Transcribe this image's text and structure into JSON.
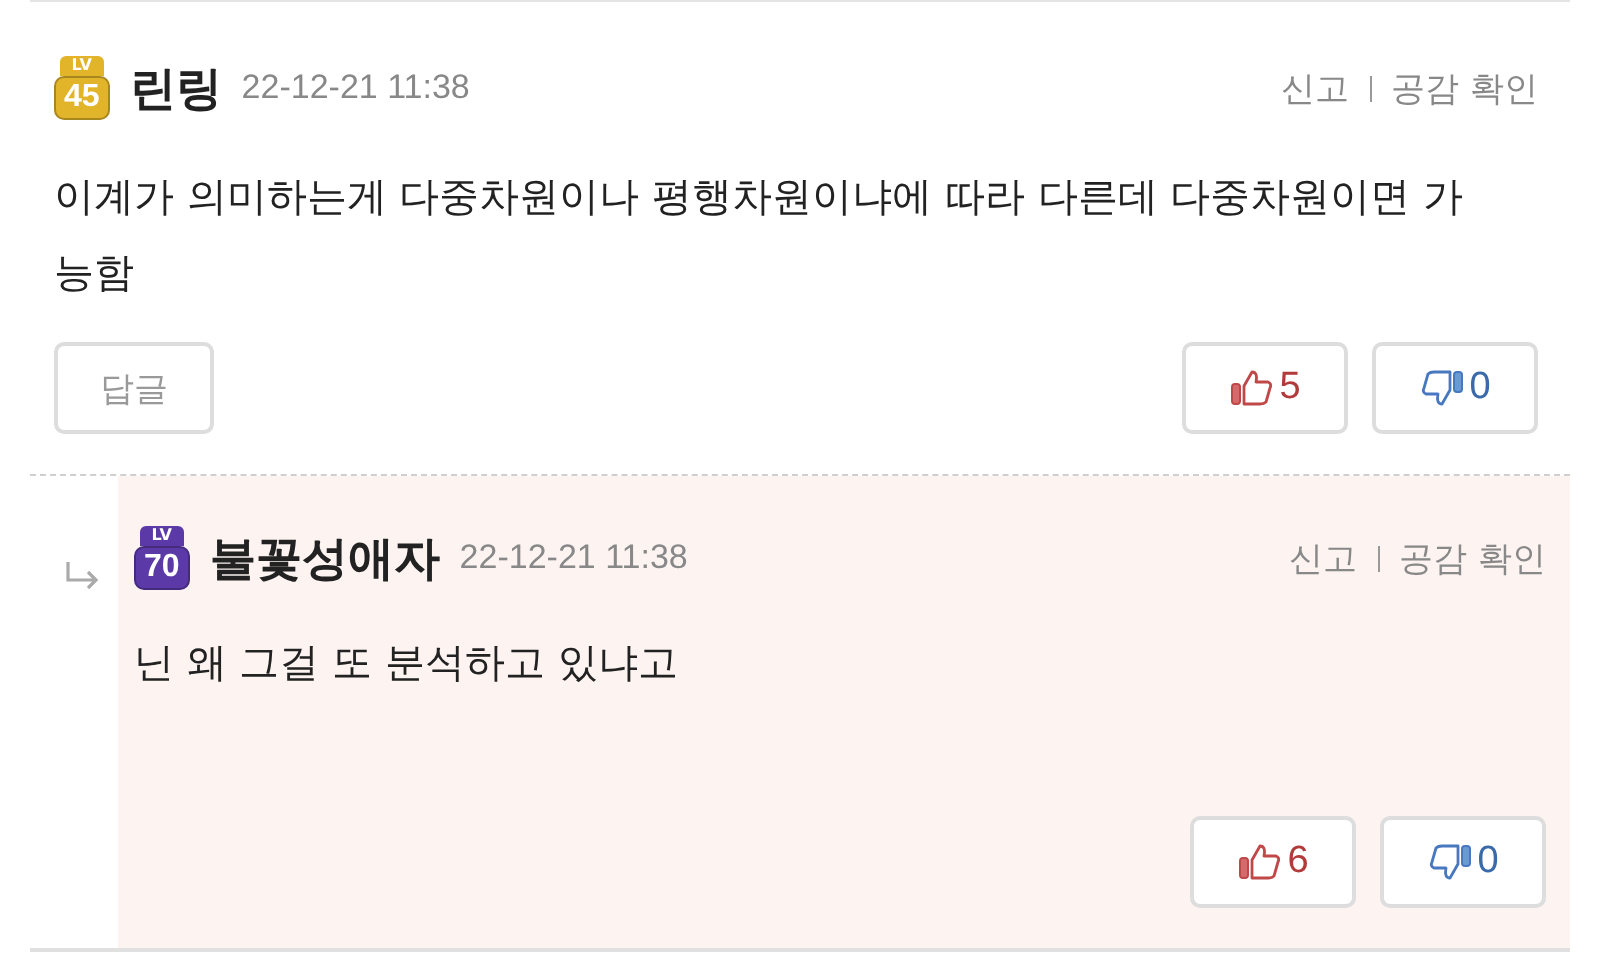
{
  "comments": [
    {
      "kind": "comment",
      "badge_label": "LV",
      "badge_level": "45",
      "color": "#e2b42a",
      "author": "린링",
      "time": "22-12-21 11:38",
      "report": "신고",
      "empathy": "공감 확인",
      "text": "이계가 의미하는게 다중차원이나 평행차원이냐에 따라 다른데 다중차원이면 가능함",
      "reply_button": "답글",
      "up": "5",
      "down": "0"
    },
    {
      "kind": "reply",
      "badge_label": "LV",
      "badge_level": "70",
      "color": "#5b3aa8",
      "author": "불꽃성애자",
      "time": "22-12-21 11:38",
      "report": "신고",
      "empathy": "공감 확인",
      "text": "닌 왜 그걸 또 분석하고 있냐고",
      "up": "6",
      "down": "0"
    }
  ]
}
